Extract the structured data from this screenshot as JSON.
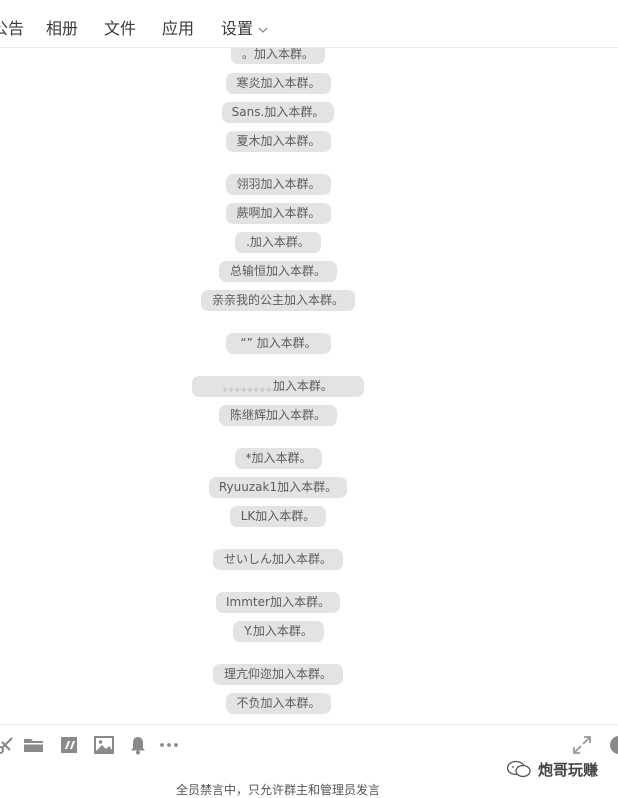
{
  "nav": {
    "partial_tab": "公告",
    "tabs": [
      "相册",
      "文件",
      "应用",
      "设置"
    ]
  },
  "messages": [
    {
      "name": "。",
      "suffix": "加入本群。"
    },
    {
      "name": "寒炎",
      "suffix": "加入本群。"
    },
    {
      "name": "Sans.",
      "suffix": "加入本群。"
    },
    {
      "name": "夏木",
      "suffix": "加入本群。"
    },
    {
      "name": "翎羽",
      "suffix": "加入本群。"
    },
    {
      "name": "蕨啊",
      "suffix": "加入本群。"
    },
    {
      "name": ".",
      "suffix": "加入本群。"
    },
    {
      "name": "总输恒",
      "suffix": "加入本群。"
    },
    {
      "name": "亲亲我的公主",
      "suffix": "加入本群。"
    },
    {
      "name": "“” ",
      "suffix": "加入本群。"
    },
    {
      "name": "ﻬ.ﻬ.ﻬ.ﻬ.ﻬ.ﻬ.ﻬ.ﻬ.",
      "suffix": "加入本群。"
    },
    {
      "name": "陈继辉",
      "suffix": "加入本群。"
    },
    {
      "name": "*",
      "suffix": "加入本群。"
    },
    {
      "name": "Ryuuzak1",
      "suffix": "加入本群。"
    },
    {
      "name": "LK",
      "suffix": "加入本群。"
    },
    {
      "name": "せいしん",
      "suffix": "加入本群。"
    },
    {
      "name": "Immter",
      "suffix": "加入本群。"
    },
    {
      "name": "Y.",
      "suffix": "加入本群。"
    },
    {
      "name": "理亢仰迩",
      "suffix": "加入本群。"
    },
    {
      "name": "不负",
      "suffix": "加入本群。"
    }
  ],
  "toolbar": {
    "icons": [
      "scissors-icon",
      "folder-icon",
      "quote-icon",
      "image-icon",
      "bell-icon",
      "more-icon",
      "expand-icon",
      "emoji-icon"
    ]
  },
  "notice": "全员禁言中，只允许群主和管理员发言",
  "watermark": "炮哥玩赚",
  "colors": {
    "pill_bg": "#e3e3e3",
    "pill_text": "#5c5c5c",
    "border": "#ebebeb"
  }
}
